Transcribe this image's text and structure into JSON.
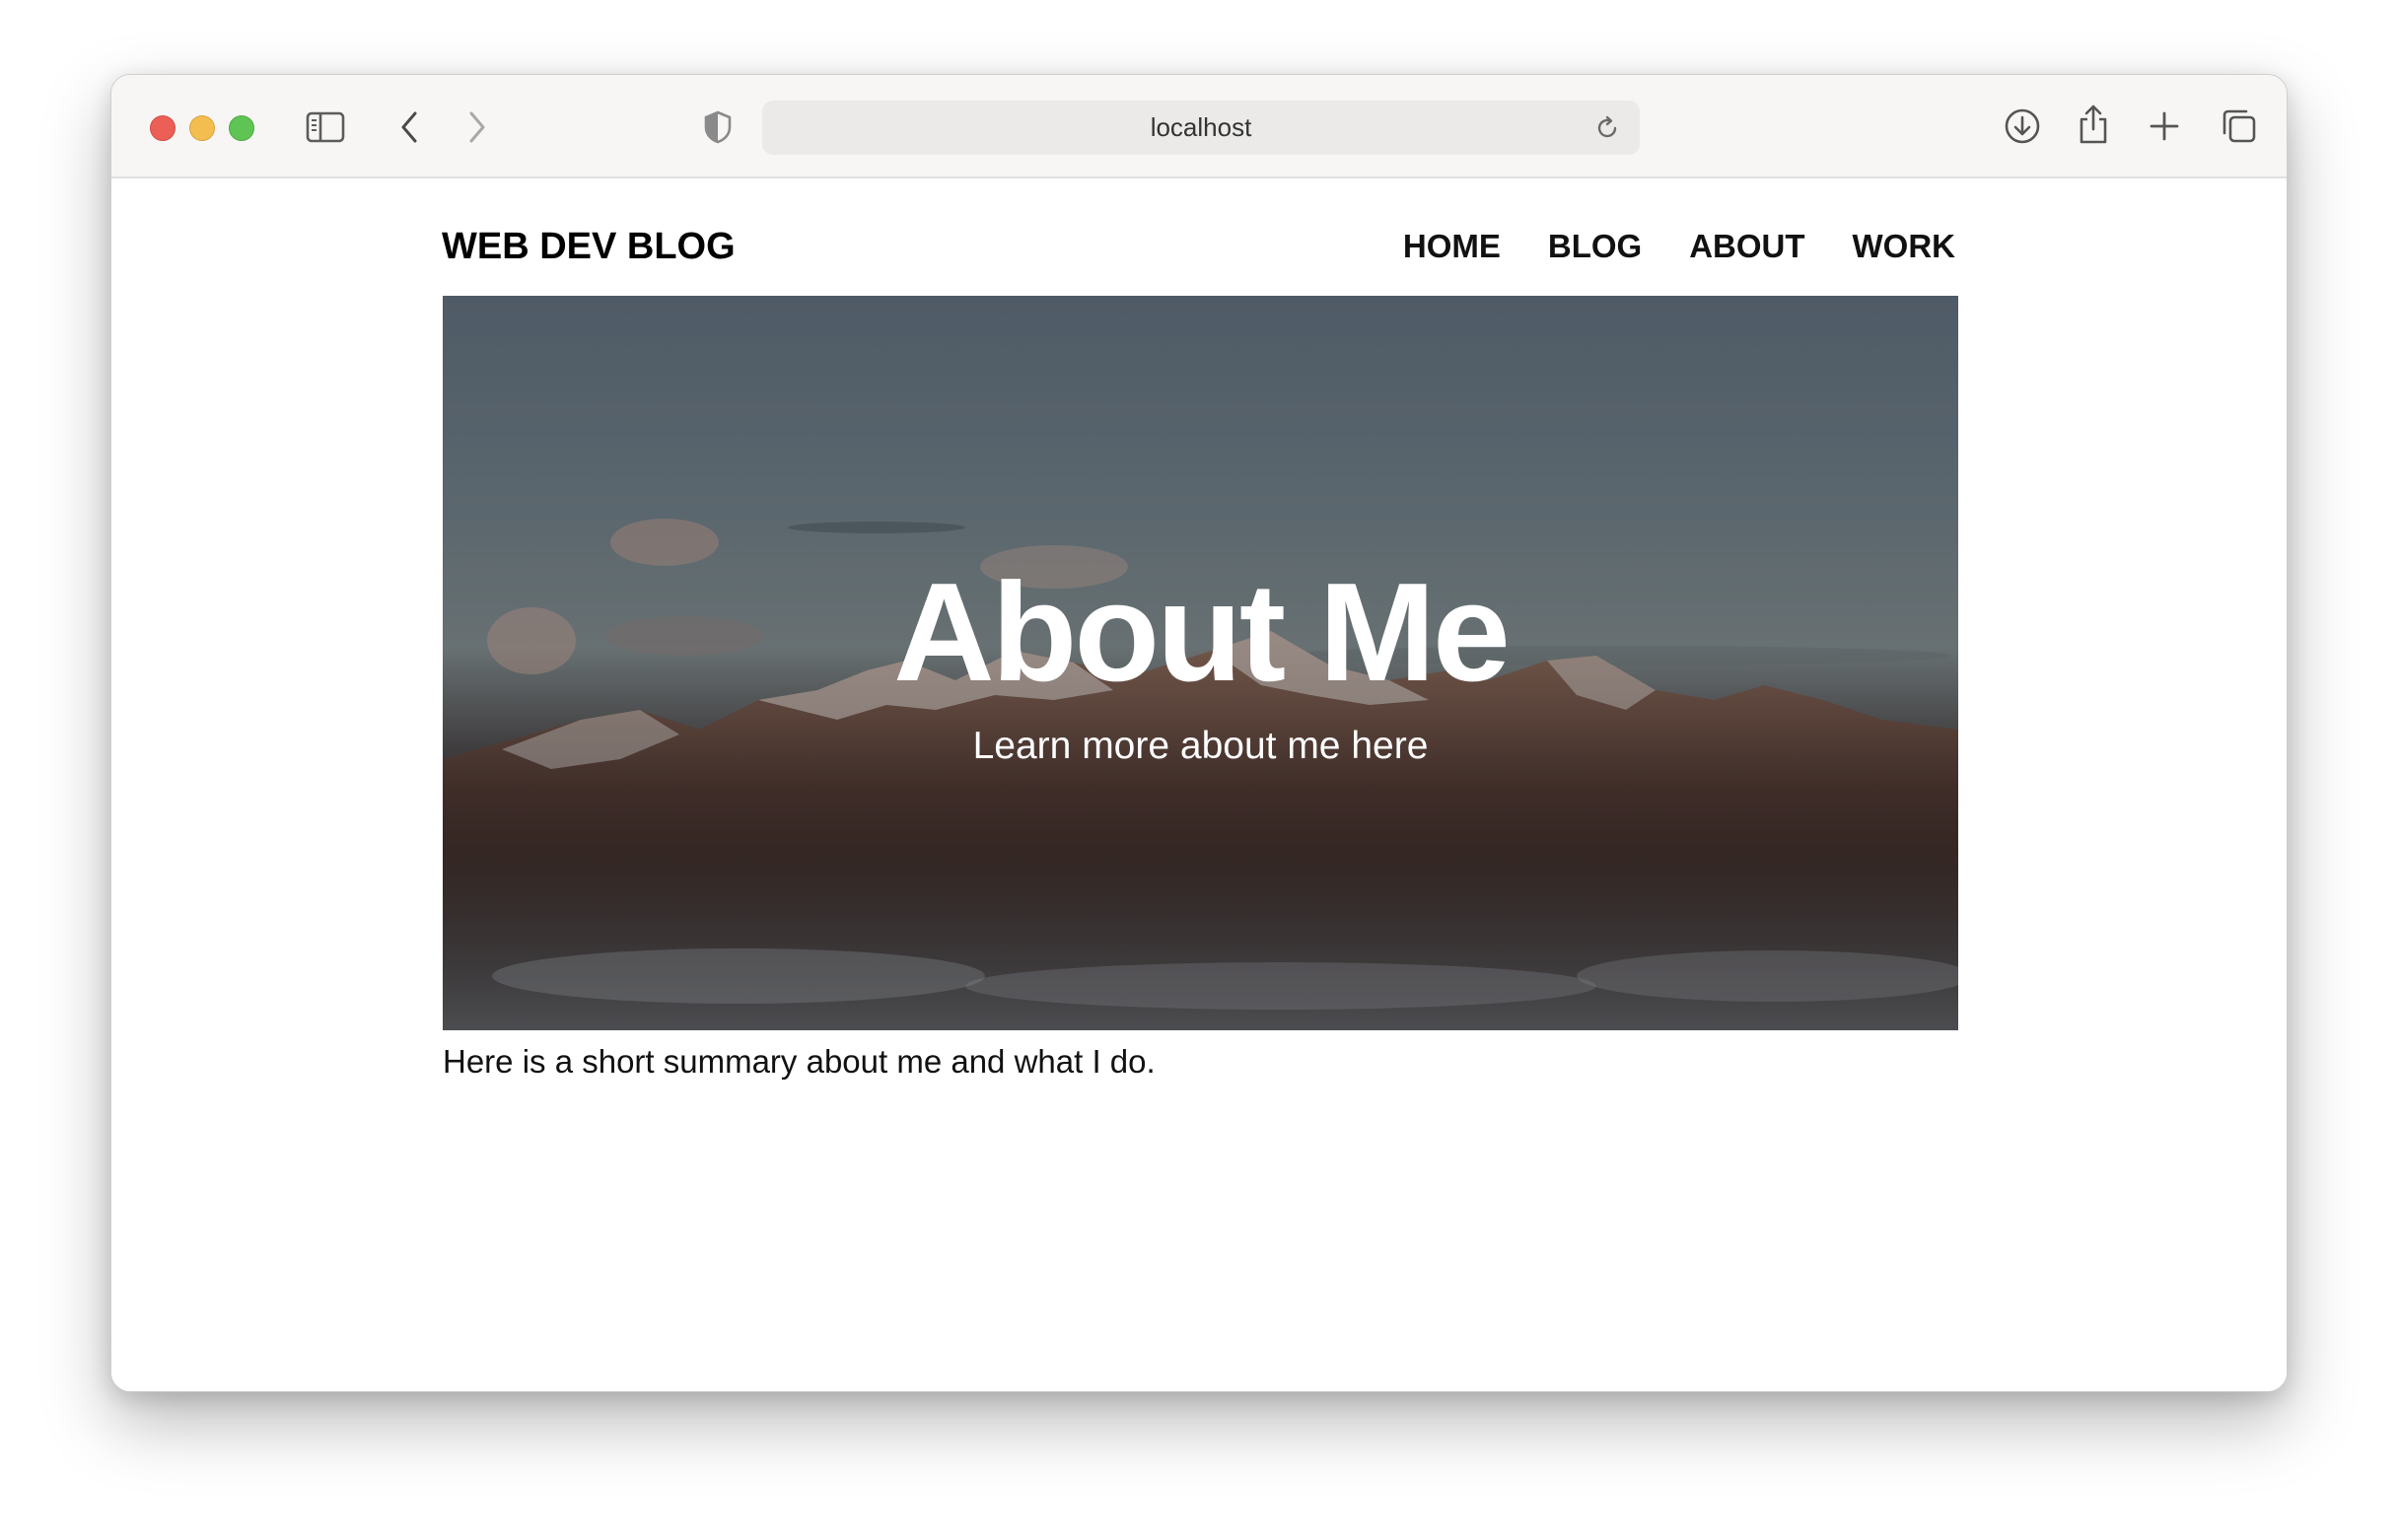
{
  "browser": {
    "url": "localhost",
    "icons": {
      "sidebar": "sidebar-icon",
      "back": "chevron-left-icon",
      "forward": "chevron-right-icon",
      "privacy": "shield-icon",
      "reload": "reload-icon",
      "download": "download-icon",
      "share": "share-icon",
      "new_tab": "plus-icon",
      "tabs": "tabs-overview-icon"
    },
    "colors": {
      "close": "#ec5f57",
      "minimize": "#f4bd4f",
      "zoom": "#5fc454"
    }
  },
  "site": {
    "title": "WEB DEV BLOG",
    "nav": [
      {
        "label": "HOME"
      },
      {
        "label": "BLOG"
      },
      {
        "label": "ABOUT"
      },
      {
        "label": "WORK"
      }
    ]
  },
  "hero": {
    "title": "About Me",
    "subtitle": "Learn more about me here"
  },
  "main": {
    "summary": "Here is a short summary about me and what I do."
  }
}
